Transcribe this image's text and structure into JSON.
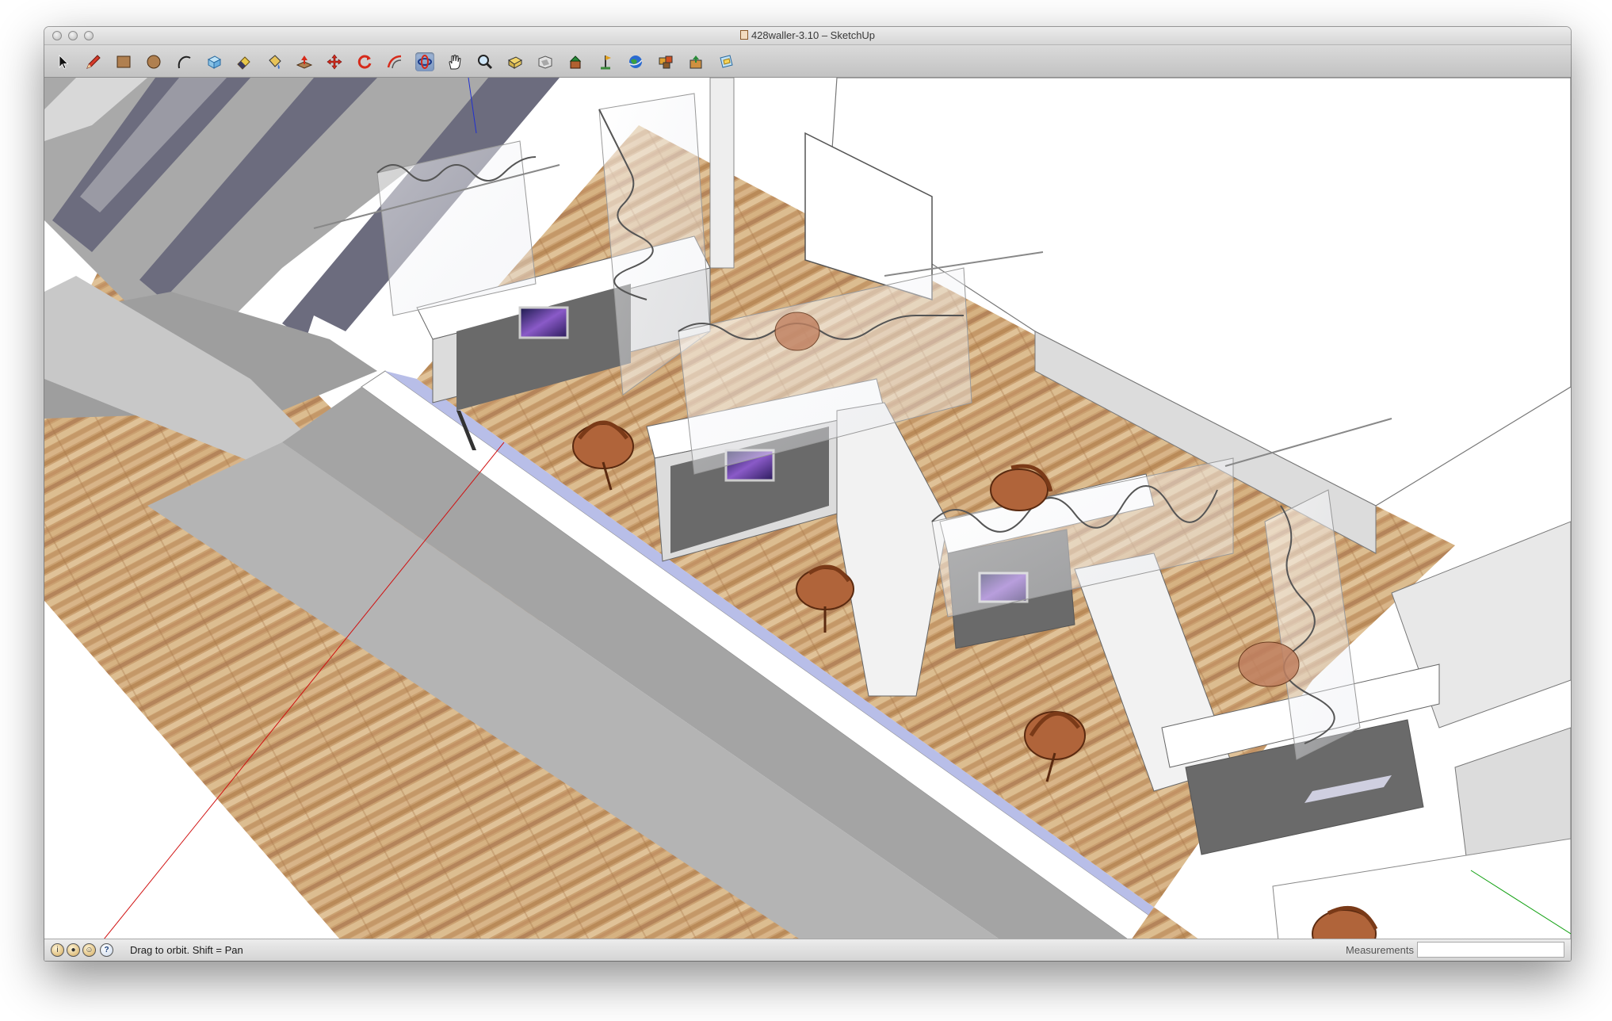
{
  "window": {
    "title": "428waller-3.10 – SketchUp"
  },
  "toolbar": {
    "tools": [
      {
        "name": "select-tool-icon"
      },
      {
        "name": "pencil-tool-icon"
      },
      {
        "name": "rectangle-tool-icon"
      },
      {
        "name": "circle-tool-icon"
      },
      {
        "name": "arc-tool-icon"
      },
      {
        "name": "make-component-icon"
      },
      {
        "name": "eraser-tool-icon"
      },
      {
        "name": "paint-bucket-icon"
      },
      {
        "name": "push-pull-icon"
      },
      {
        "name": "move-tool-icon"
      },
      {
        "name": "rotate-tool-icon"
      },
      {
        "name": "offset-tool-icon"
      },
      {
        "name": "orbit-tool-icon"
      },
      {
        "name": "pan-tool-icon"
      },
      {
        "name": "zoom-tool-icon"
      },
      {
        "name": "zoom-extents-icon"
      },
      {
        "name": "previous-view-icon"
      },
      {
        "name": "get-models-icon"
      },
      {
        "name": "add-location-icon"
      },
      {
        "name": "google-earth-icon"
      },
      {
        "name": "component-browser-icon"
      },
      {
        "name": "share-model-icon"
      },
      {
        "name": "send-to-layout-icon"
      }
    ],
    "active_tool": "orbit-tool-icon"
  },
  "status": {
    "hint": "Drag to orbit.  Shift = Pan",
    "measurements_label": "Measurements",
    "measurements_value": ""
  },
  "colors": {
    "wood": "#c9a070",
    "wall": "#a8a8a8",
    "wall_dark": "#6c6c78",
    "desk": "#6a6a6a",
    "chair": "#b0643a",
    "axis_red": "#d01010",
    "axis_green": "#10a010",
    "axis_blue": "#2030d0"
  }
}
